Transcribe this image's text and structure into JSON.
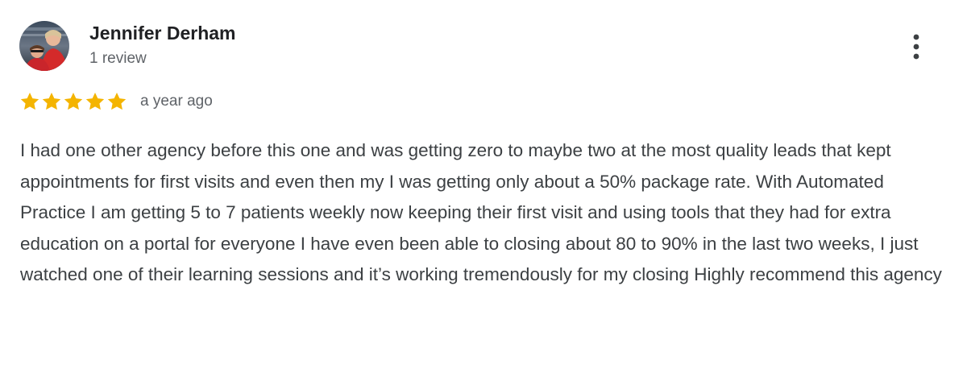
{
  "review": {
    "author_name": "Jennifer Derham",
    "review_count": "1 review",
    "rating": 5,
    "rating_max": 5,
    "date": "a year ago",
    "text": "I had one other agency before this one and was getting zero to maybe two at the most quality leads that kept appointments for first visits and even then my I was getting only about a 50% package rate. With Automated Practice I am getting 5 to 7 patients weekly now keeping their first visit and using tools that they had for extra education on a portal for everyone I have even been able to closing about 80 to 90% in the last two weeks, I just watched one of their learning sessions and it’s working tremendously for my closing Highly recommend this agency"
  },
  "icons": {
    "more": "more-vert-icon",
    "star": "star-icon",
    "avatar": "profile-photo"
  },
  "colors": {
    "star_fill": "#F4B400",
    "name_text": "#202124",
    "meta_text": "#5f6368",
    "body_text": "#3c4043",
    "more_icon": "#3c4043"
  }
}
